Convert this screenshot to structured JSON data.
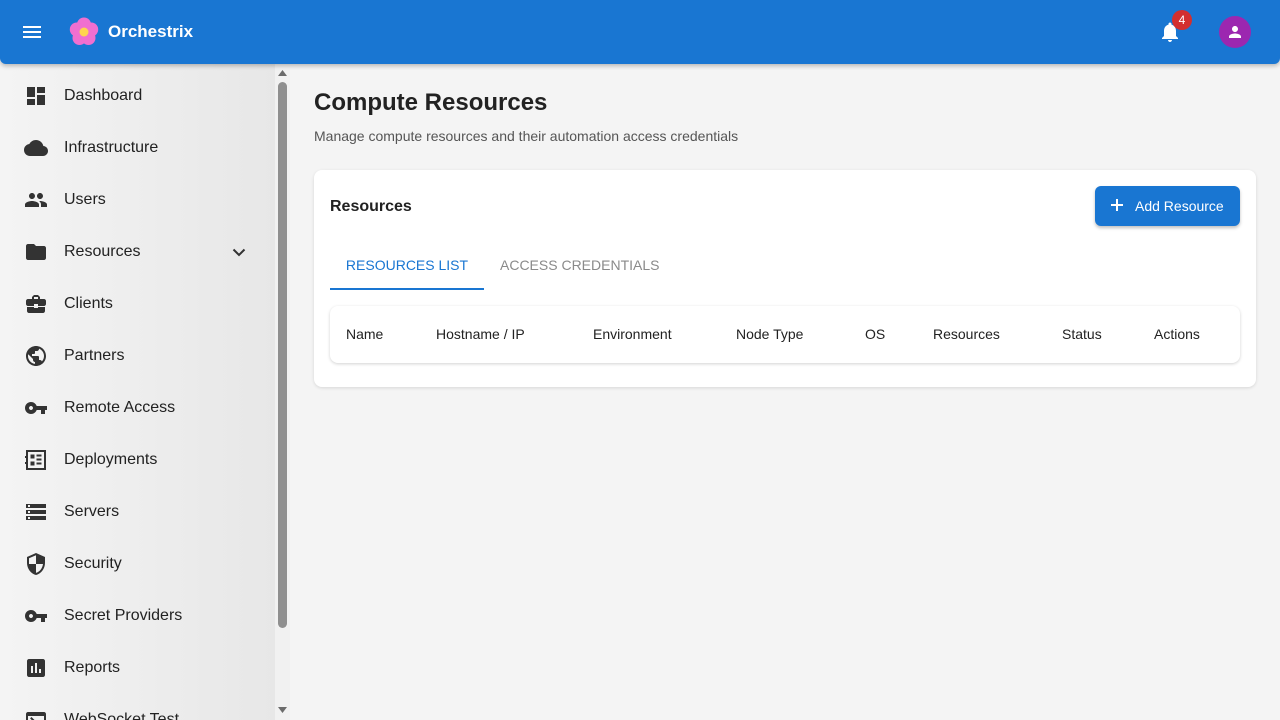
{
  "app": {
    "title": "Orchestrix"
  },
  "header": {
    "notifications_count": "4"
  },
  "sidebar": {
    "items": [
      {
        "label": "Dashboard",
        "icon": "dashboard-icon"
      },
      {
        "label": "Infrastructure",
        "icon": "cloud-icon"
      },
      {
        "label": "Users",
        "icon": "people-icon"
      },
      {
        "label": "Resources",
        "icon": "folder-icon"
      },
      {
        "label": "Clients",
        "icon": "briefcase-icon"
      },
      {
        "label": "Partners",
        "icon": "globe-icon"
      },
      {
        "label": "Remote Access",
        "icon": "key-icon"
      },
      {
        "label": "Deployments",
        "icon": "deployments-icon"
      },
      {
        "label": "Servers",
        "icon": "server-list-icon"
      },
      {
        "label": "Security",
        "icon": "shield-icon"
      },
      {
        "label": "Secret Providers",
        "icon": "key-icon"
      },
      {
        "label": "Reports",
        "icon": "bar-chart-icon"
      },
      {
        "label": "WebSocket Test",
        "icon": "terminal-icon"
      }
    ]
  },
  "main": {
    "title": "Compute Resources",
    "subtitle": "Manage compute resources and their automation access credentials",
    "card": {
      "title": "Resources",
      "add_button": "Add Resource",
      "tabs": [
        {
          "label": "Resources List",
          "active": true
        },
        {
          "label": "Access Credentials",
          "active": false
        }
      ],
      "columns": [
        "Name",
        "Hostname / IP",
        "Environment",
        "Node Type",
        "OS",
        "Resources",
        "Status",
        "Actions"
      ]
    }
  },
  "colors": {
    "primary": "#1976d2",
    "badge": "#d32f2f",
    "avatar": "#9c27b0"
  }
}
